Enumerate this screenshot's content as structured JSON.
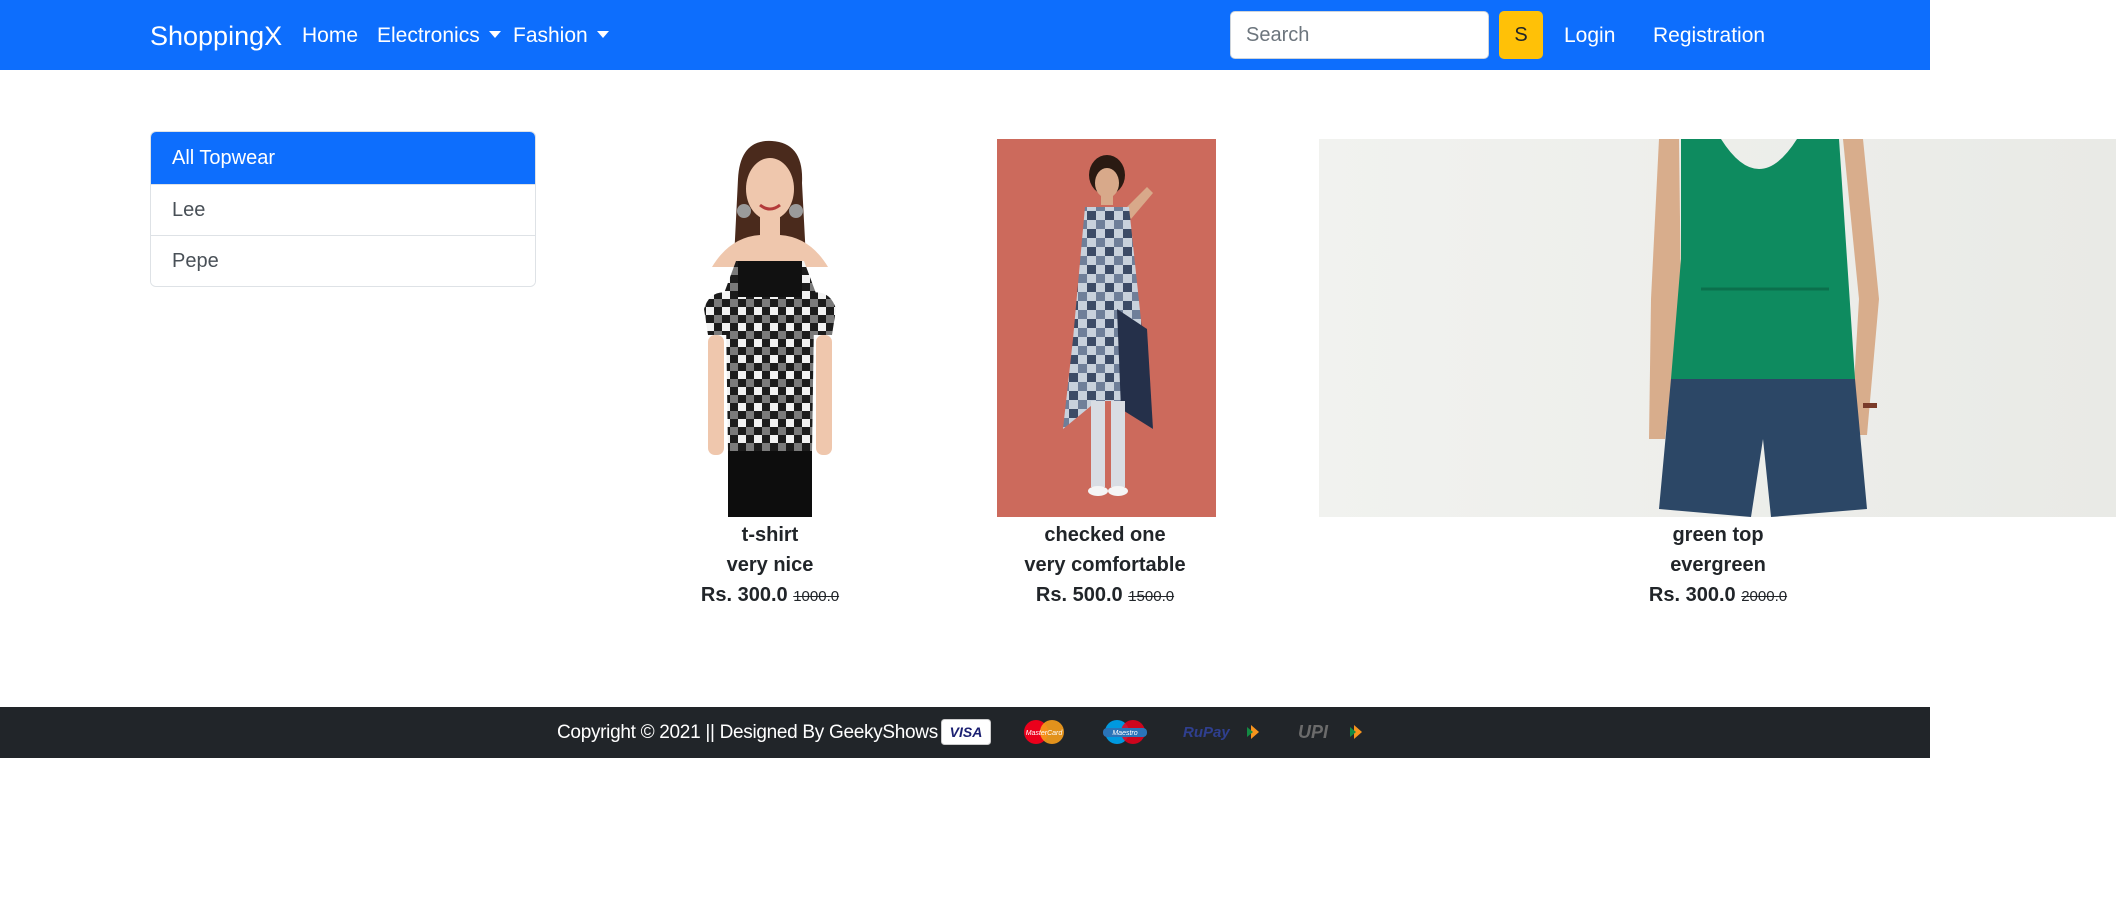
{
  "navbar": {
    "brand": "ShoppingX",
    "home": "Home",
    "electronics": "Electronics",
    "fashion": "Fashion",
    "search_placeholder": "Search",
    "search_button": "S",
    "login": "Login",
    "registration": "Registration"
  },
  "sidebar": {
    "items": [
      {
        "label": "All Topwear",
        "active": true
      },
      {
        "label": "Lee",
        "active": false
      },
      {
        "label": "Pepe",
        "active": false
      }
    ]
  },
  "products": [
    {
      "name": "t-shirt",
      "description": "very nice",
      "price": "Rs. 300.0",
      "mrp": "1000.0"
    },
    {
      "name": "checked one",
      "description": "very comfortable",
      "price": "Rs. 500.0",
      "mrp": "1500.0"
    },
    {
      "name": "green top",
      "description": "evergreen",
      "price": "Rs. 300.0",
      "mrp": "2000.0"
    }
  ],
  "footer": {
    "copyright": "Copyright © 2021 || Designed By GeekyShows ||",
    "payment_methods": [
      "VISA",
      "MasterCard",
      "Maestro",
      "RuPay",
      "UPI"
    ]
  },
  "colors": {
    "primary": "#0d6efd",
    "warning": "#ffc107",
    "dark": "#212529"
  }
}
